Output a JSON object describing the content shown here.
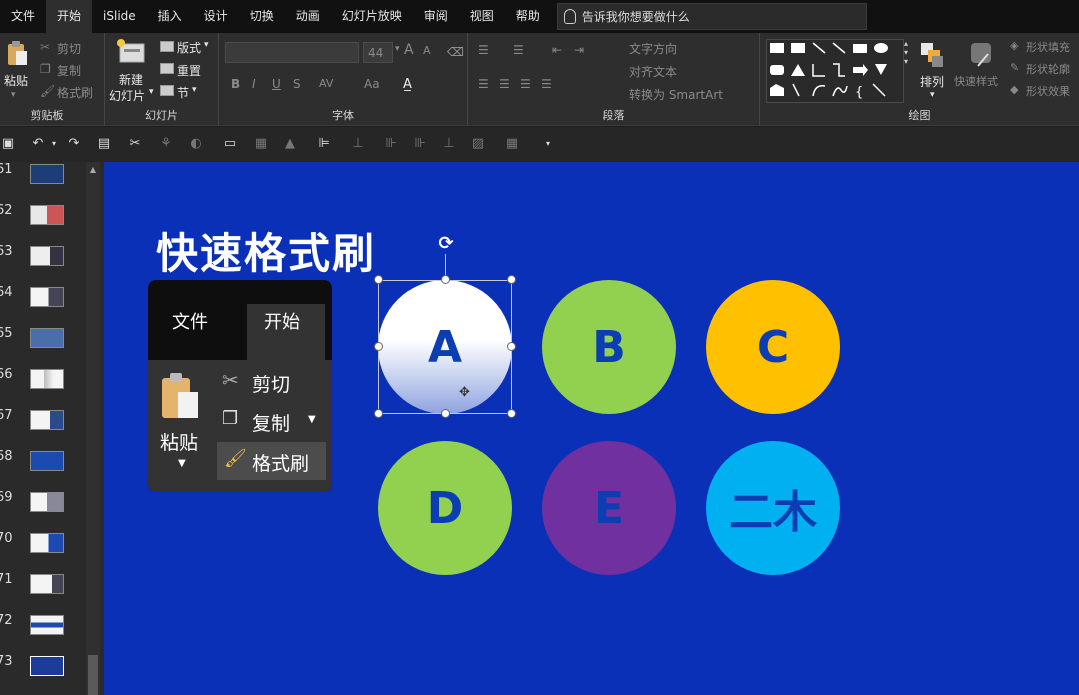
{
  "menu": {
    "tabs": [
      "文件",
      "开始",
      "iSlide",
      "插入",
      "设计",
      "切换",
      "动画",
      "幻灯片放映",
      "审阅",
      "视图",
      "帮助"
    ],
    "active_index": 1,
    "tell_me": "告诉我你想要做什么"
  },
  "ribbon": {
    "clipboard": {
      "paste": "粘贴",
      "cut": "剪切",
      "copy": "复制",
      "format_painter": "格式刷",
      "label": "剪贴板"
    },
    "slides": {
      "new_slide_1": "新建",
      "new_slide_2": "幻灯片",
      "layout": "版式",
      "reset": "重置",
      "section": "节",
      "label": "幻灯片"
    },
    "font": {
      "size": "44",
      "bold": "B",
      "italic": "I",
      "underline": "U",
      "strike": "S",
      "spacing": "AV",
      "case": "Aa",
      "grow": "A",
      "shrink": "A",
      "label": "字体"
    },
    "paragraph": {
      "text_direction": "文字方向",
      "align_text": "对齐文本",
      "smartart": "转换为 SmartArt",
      "label": "段落"
    },
    "drawing": {
      "arrange": "排列",
      "quick_styles": "快速样式",
      "shape_fill": "形状填充",
      "shape_outline": "形状轮廓",
      "shape_effects": "形状效果",
      "label": "绘图"
    }
  },
  "thumbnails": [
    {
      "num": "61"
    },
    {
      "num": "62"
    },
    {
      "num": "63"
    },
    {
      "num": "64"
    },
    {
      "num": "65"
    },
    {
      "num": "66"
    },
    {
      "num": "67"
    },
    {
      "num": "68"
    },
    {
      "num": "69"
    },
    {
      "num": "70"
    },
    {
      "num": "71"
    },
    {
      "num": "72"
    },
    {
      "num": "73"
    }
  ],
  "slide": {
    "title": "快速格式刷",
    "popup": {
      "tab_file": "文件",
      "tab_home": "开始",
      "paste": "粘贴",
      "cut": "剪切",
      "copy": "复制",
      "format_painter": "格式刷"
    },
    "circles": [
      {
        "label": "A",
        "color": "#ffffff"
      },
      {
        "label": "B",
        "color": "#92d050"
      },
      {
        "label": "C",
        "color": "#ffc000"
      },
      {
        "label": "D",
        "color": "#92d050"
      },
      {
        "label": "E",
        "color": "#7030a0"
      },
      {
        "label": "二木",
        "color": "#00b0f0"
      }
    ]
  },
  "colors": {
    "slide_bg": "#0b30b8",
    "circle_text": "#0b3db3"
  }
}
